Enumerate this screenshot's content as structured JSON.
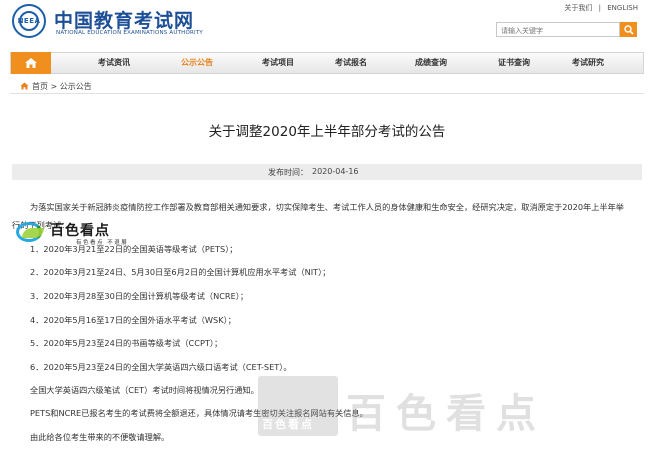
{
  "header": {
    "logo_emblem_text": "NEEA",
    "logo_title": "中国教育考试网",
    "logo_subtitle": "NATIONAL EDUCATION EXAMINATIONS AUTHORITY",
    "top_links": [
      "关于我们",
      "ENGLISH"
    ],
    "top_link_sep": "|",
    "search_placeholder": "请输入关键字"
  },
  "nav": {
    "items": [
      "考试资讯",
      "公示公告",
      "考试项目",
      "考试报名",
      "成绩查询",
      "证书查询",
      "考试研究"
    ],
    "active": "公示公告"
  },
  "breadcrumb": {
    "home": "首页",
    "sep": ">",
    "current": "公示公告"
  },
  "article": {
    "title": "关于调整2020年上半年部分考试的公告",
    "published_label": "发布时间：",
    "published_date": "2020-04-16",
    "intro": "为落实国家关于新冠肺炎疫情防控工作部署及教育部相关通知要求，切实保障考生、考试工作人员的身体健康和生命安全，经研究决定，取消原定于2020年上半年举",
    "intro_cont": "行的下列考试：",
    "items": [
      "1．2020年3月21至22日的全国英语等级考试（PETS）；",
      "2．2020年3月21至24日、5月30日至6月2日的全国计算机应用水平考试（NIT）；",
      "3．2020年3月28至30日的全国计算机等级考试（NCRE）；",
      "4．2020年5月16至17日的全国外语水平考试（WSK）；",
      "5．2020年5月23至24日的书画等级考试（CCPT）；",
      "6．2020年5月23至24日的全国大学英语四六级口语考试（CET-SET）。"
    ],
    "notes": [
      "全国大学英语四六级笔试（CET）考试时间将视情况另行通知。",
      "PETS和NCRE已报名考生的考试费将全额退还，具体情况请考生密切关注报名网站有关信息。",
      "由此给各位考生带来的不便敬请理解。"
    ]
  },
  "watermark": {
    "small_main": "百色看点",
    "small_sub": "有色看点 不退展",
    "big": "百色看点",
    "box": "百色看点"
  },
  "colors": {
    "brand_blue": "#1d4f97",
    "accent_orange": "#f08f1d",
    "active_nav": "#e8801b"
  }
}
